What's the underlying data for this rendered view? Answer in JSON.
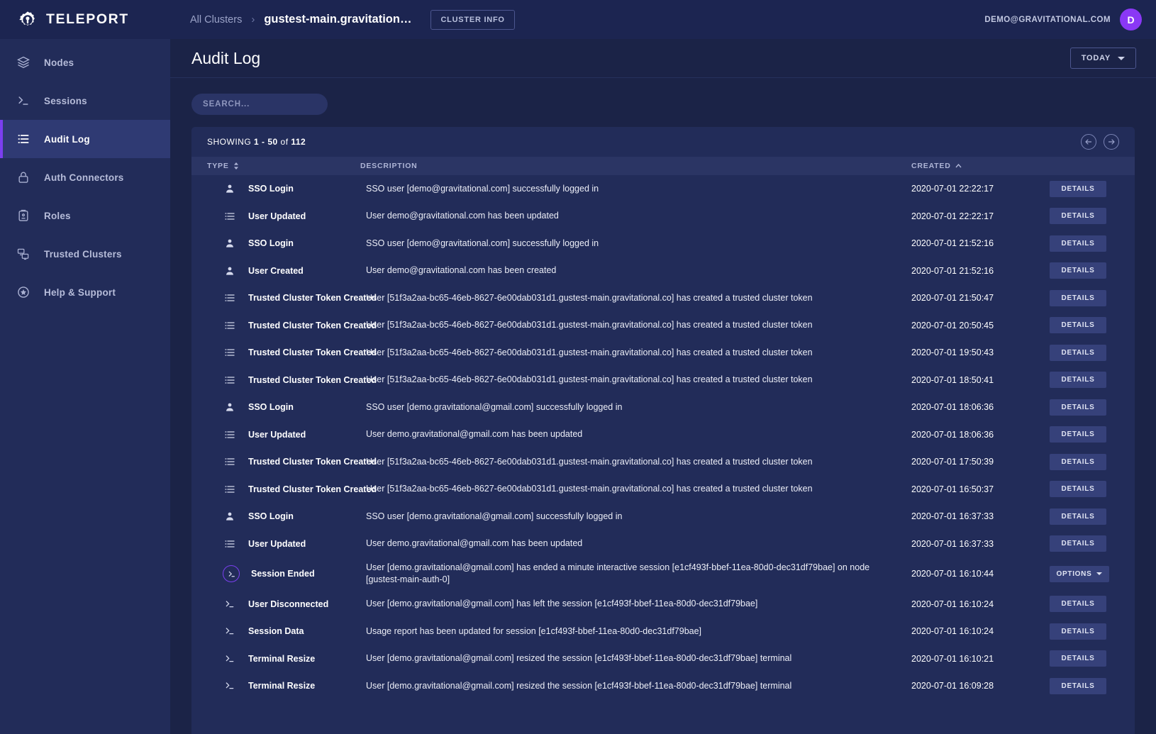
{
  "brand": {
    "name": "TELEPORT",
    "logo_icon": "teleport-gear-icon"
  },
  "breadcrumb": {
    "all_clusters": "All Clusters",
    "separator": "›",
    "current": "gustest-main.gravitation…",
    "cluster_info_label": "CLUSTER INFO"
  },
  "account": {
    "email": "DEMO@GRAVITATIONAL.COM",
    "avatar_initial": "D",
    "avatar_color": "#8a38f5"
  },
  "sidebar": {
    "items": [
      {
        "label": "Nodes",
        "icon": "layers-icon",
        "active": false
      },
      {
        "label": "Sessions",
        "icon": "terminal-icon",
        "active": false
      },
      {
        "label": "Audit Log",
        "icon": "list-icon",
        "active": true
      },
      {
        "label": "Auth Connectors",
        "icon": "lock-icon",
        "active": false
      },
      {
        "label": "Roles",
        "icon": "clipboard-icon",
        "active": false
      },
      {
        "label": "Trusted Clusters",
        "icon": "clusters-icon",
        "active": false
      },
      {
        "label": "Help & Support",
        "icon": "star-circle-icon",
        "active": false
      }
    ]
  },
  "page": {
    "title": "Audit Log",
    "range_filter_label": "TODAY",
    "search_placeholder": "SEARCH...",
    "search_value": ""
  },
  "table": {
    "showing_prefix": "SHOWING ",
    "showing_range": "1 - 50",
    "showing_mid": " of ",
    "showing_total": "112",
    "prev_icon": "arrow-left-circle-icon",
    "next_icon": "arrow-right-circle-icon",
    "columns": [
      {
        "label": "TYPE",
        "sort": "unsorted"
      },
      {
        "label": "DESCRIPTION",
        "sort": "none"
      },
      {
        "label": "CREATED",
        "sort": "asc"
      }
    ],
    "rows": [
      {
        "icon": "user-icon",
        "type": "SSO Login",
        "description": "SSO user [demo@gravitational.com] successfully logged in",
        "created": "2020-07-01 22:22:17",
        "action": "DETAILS"
      },
      {
        "icon": "list-icon",
        "type": "User Updated",
        "description": "User demo@gravitational.com has been updated",
        "created": "2020-07-01 22:22:17",
        "action": "DETAILS"
      },
      {
        "icon": "user-icon",
        "type": "SSO Login",
        "description": "SSO user [demo@gravitational.com] successfully logged in",
        "created": "2020-07-01 21:52:16",
        "action": "DETAILS"
      },
      {
        "icon": "user-icon",
        "type": "User Created",
        "description": "User demo@gravitational.com has been created",
        "created": "2020-07-01 21:52:16",
        "action": "DETAILS"
      },
      {
        "icon": "list-icon",
        "type": "Trusted Cluster Token Created",
        "description": "User [51f3a2aa-bc65-46eb-8627-6e00dab031d1.gustest-main.gravitational.co] has created a trusted cluster token",
        "created": "2020-07-01 21:50:47",
        "action": "DETAILS"
      },
      {
        "icon": "list-icon",
        "type": "Trusted Cluster Token Created",
        "description": "User [51f3a2aa-bc65-46eb-8627-6e00dab031d1.gustest-main.gravitational.co] has created a trusted cluster token",
        "created": "2020-07-01 20:50:45",
        "action": "DETAILS"
      },
      {
        "icon": "list-icon",
        "type": "Trusted Cluster Token Created",
        "description": "User [51f3a2aa-bc65-46eb-8627-6e00dab031d1.gustest-main.gravitational.co] has created a trusted cluster token",
        "created": "2020-07-01 19:50:43",
        "action": "DETAILS"
      },
      {
        "icon": "list-icon",
        "type": "Trusted Cluster Token Created",
        "description": "User [51f3a2aa-bc65-46eb-8627-6e00dab031d1.gustest-main.gravitational.co] has created a trusted cluster token",
        "created": "2020-07-01 18:50:41",
        "action": "DETAILS"
      },
      {
        "icon": "user-icon",
        "type": "SSO Login",
        "description": "SSO user [demo.gravitational@gmail.com] successfully logged in",
        "created": "2020-07-01 18:06:36",
        "action": "DETAILS"
      },
      {
        "icon": "list-icon",
        "type": "User Updated",
        "description": "User demo.gravitational@gmail.com has been updated",
        "created": "2020-07-01 18:06:36",
        "action": "DETAILS"
      },
      {
        "icon": "list-icon",
        "type": "Trusted Cluster Token Created",
        "description": "User [51f3a2aa-bc65-46eb-8627-6e00dab031d1.gustest-main.gravitational.co] has created a trusted cluster token",
        "created": "2020-07-01 17:50:39",
        "action": "DETAILS"
      },
      {
        "icon": "list-icon",
        "type": "Trusted Cluster Token Created",
        "description": "User [51f3a2aa-bc65-46eb-8627-6e00dab031d1.gustest-main.gravitational.co] has created a trusted cluster token",
        "created": "2020-07-01 16:50:37",
        "action": "DETAILS"
      },
      {
        "icon": "user-icon",
        "type": "SSO Login",
        "description": "SSO user [demo.gravitational@gmail.com] successfully logged in",
        "created": "2020-07-01 16:37:33",
        "action": "DETAILS"
      },
      {
        "icon": "list-icon",
        "type": "User Updated",
        "description": "User demo.gravitational@gmail.com has been updated",
        "created": "2020-07-01 16:37:33",
        "action": "DETAILS"
      },
      {
        "icon": "terminal-ring-icon",
        "type": "Session Ended",
        "description": "User [demo.gravitational@gmail.com] has ended a minute interactive session [e1cf493f-bbef-11ea-80d0-dec31df79bae] on node [gustest-main-auth-0]",
        "created": "2020-07-01 16:10:44",
        "action": "OPTIONS",
        "action_type": "dropdown",
        "tall": true
      },
      {
        "icon": "terminal-icon",
        "type": "User Disconnected",
        "description": "User [demo.gravitational@gmail.com] has left the session [e1cf493f-bbef-11ea-80d0-dec31df79bae]",
        "created": "2020-07-01 16:10:24",
        "action": "DETAILS"
      },
      {
        "icon": "terminal-icon",
        "type": "Session Data",
        "description": "Usage report has been updated for session [e1cf493f-bbef-11ea-80d0-dec31df79bae]",
        "created": "2020-07-01 16:10:24",
        "action": "DETAILS"
      },
      {
        "icon": "terminal-icon",
        "type": "Terminal Resize",
        "description": "User [demo.gravitational@gmail.com] resized the session [e1cf493f-bbef-11ea-80d0-dec31df79bae] terminal",
        "created": "2020-07-01 16:10:21",
        "action": "DETAILS"
      },
      {
        "icon": "terminal-icon",
        "type": "Terminal Resize",
        "description": "User [demo.gravitational@gmail.com] resized the session [e1cf493f-bbef-11ea-80d0-dec31df79bae] terminal",
        "created": "2020-07-01 16:09:28",
        "action": "DETAILS"
      }
    ]
  }
}
